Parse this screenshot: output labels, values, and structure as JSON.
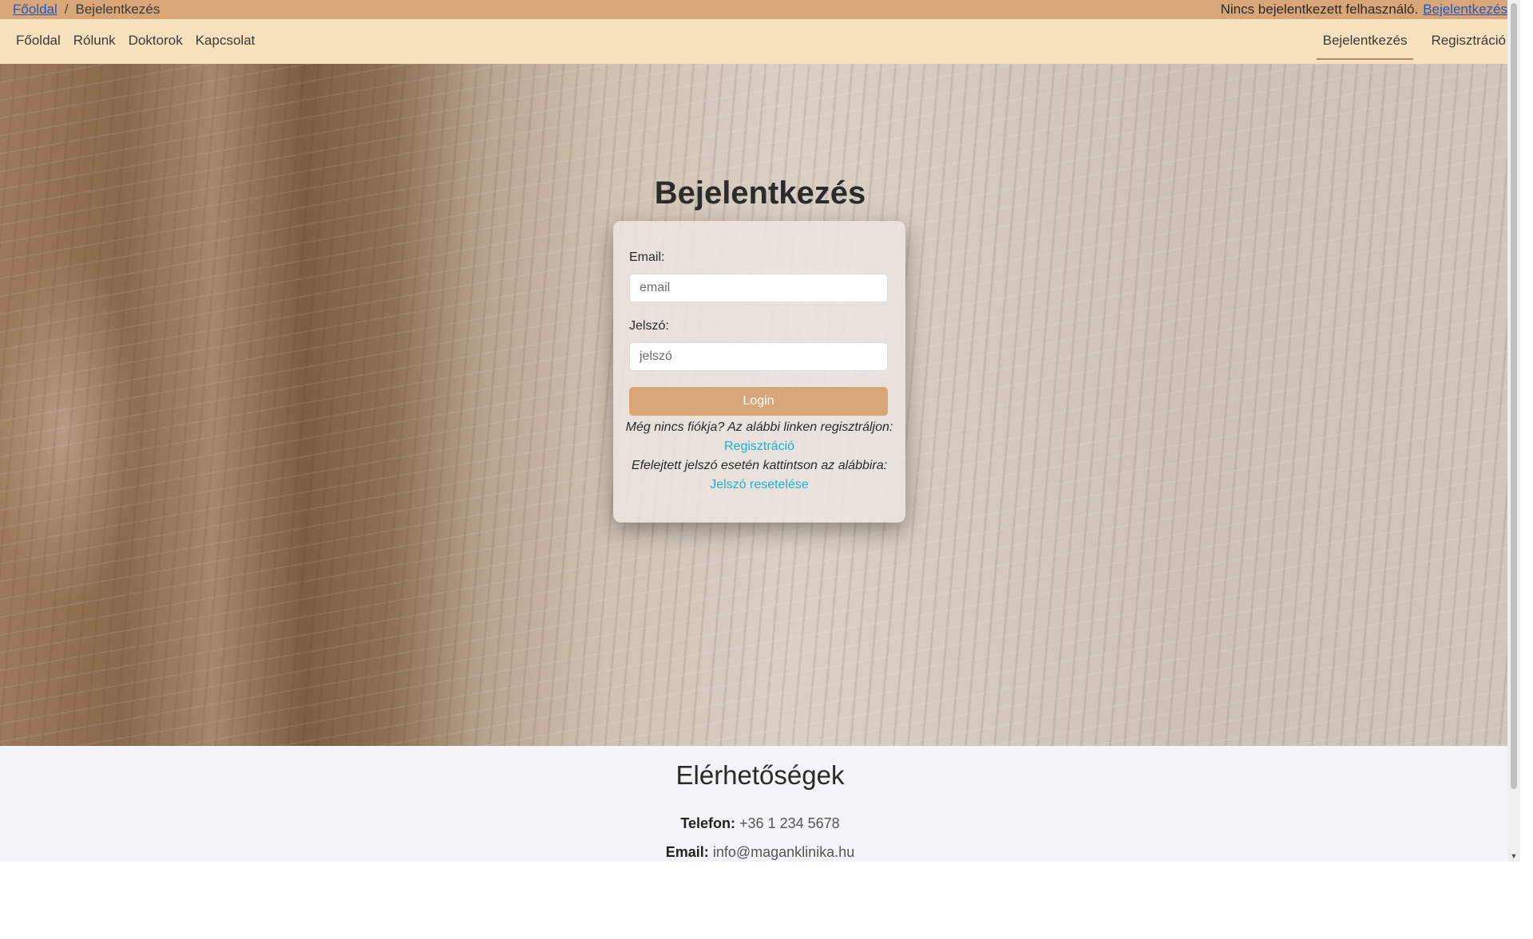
{
  "topbar": {
    "breadcrumb": {
      "home": "Főoldal",
      "separator": "/",
      "current": "Bejelentkezés"
    },
    "status_text": "Nincs bejelentkezett felhasználó.",
    "status_link": "Bejelentkezés"
  },
  "navbar": {
    "left_items": [
      {
        "label": "Főoldal"
      },
      {
        "label": "Rólunk"
      },
      {
        "label": "Doktorok"
      },
      {
        "label": "Kapcsolat"
      }
    ],
    "right_items": [
      {
        "label": "Bejelentkezés",
        "active": true
      },
      {
        "label": "Regisztráció",
        "active": false
      }
    ]
  },
  "login": {
    "title": "Bejelentkezés",
    "email_label": "Email:",
    "email_placeholder": "email",
    "password_label": "Jelszó:",
    "password_placeholder": "jelszó",
    "submit_label": "Login",
    "no_account_text": "Még nincs fiókja? Az alábbi linken regisztráljon:",
    "register_link": "Regisztráció",
    "forgot_text": "Efelejtett jelszó esetén kattintson az alábbira:",
    "reset_link": "Jelszó resetelése"
  },
  "footer": {
    "title": "Elérhetőségek",
    "phone_label": "Telefon:",
    "phone_value": "+36 1 234 5678",
    "email_label": "Email:",
    "email_value": "info@maganklinika.hu"
  },
  "colors": {
    "topbar_bg": "#d9a677",
    "navbar_bg": "#f7e1bd",
    "button_bg": "#d9a677",
    "link_color": "#1ab3d4"
  }
}
